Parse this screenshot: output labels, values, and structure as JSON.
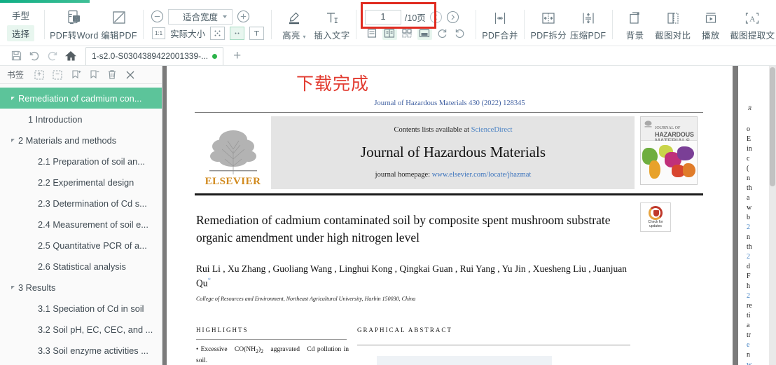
{
  "app": {
    "accent_color": "#13b188",
    "highlight_box_color": "#e02b20"
  },
  "ribbon": {
    "hand_label": "手型",
    "select_label": "选择",
    "buttons": [
      {
        "name": "pdf-to-word",
        "label": "PDF转Word",
        "icon": "word-convert-icon"
      },
      {
        "name": "edit-pdf",
        "label": "编辑PDF",
        "icon": "pencil-square-icon"
      }
    ],
    "zoom": {
      "minus_label": "−",
      "plus_label": "+",
      "level": "适合宽度",
      "actual_size_label": "实际大小",
      "ratio_badge": "1:1"
    },
    "annotate": [
      {
        "name": "highlight",
        "label": "高亮",
        "icon": "marker-icon",
        "has_dropdown": true
      },
      {
        "name": "insert-text",
        "label": "插入文字",
        "icon": "text-insert-icon"
      }
    ],
    "pagenav": {
      "current_page": "1",
      "total_label": "/10页",
      "prev_title": "上一页",
      "next_title": "下一页"
    },
    "tools": [
      {
        "name": "pdf-merge",
        "label": "PDF合并",
        "icon": "merge-icon"
      },
      {
        "name": "pdf-split",
        "label": "PDF拆分",
        "icon": "split-icon"
      },
      {
        "name": "compress-pdf",
        "label": "压缩PDF",
        "icon": "compress-icon"
      },
      {
        "name": "background",
        "label": "背景",
        "icon": "layers-icon"
      },
      {
        "name": "screenshot-compare",
        "label": "截图对比",
        "icon": "compare-icon"
      },
      {
        "name": "play",
        "label": "播放",
        "icon": "play-icon"
      },
      {
        "name": "screenshot-ocr",
        "label": "截图提取文",
        "icon": "ocr-icon"
      }
    ]
  },
  "tabstrip": {
    "save_title": "保存",
    "undo_title": "撤销",
    "redo_title": "恢复",
    "home_title": "首页",
    "tab_label": "1-s2.0-S0304389422001339-...",
    "add_tab_label": "+"
  },
  "sidebar": {
    "title": "书签",
    "tools": [
      {
        "name": "expand-all-icon",
        "label": "展开全部"
      },
      {
        "name": "collapse-all-icon",
        "label": "折叠全部"
      },
      {
        "name": "add-bookmark-icon",
        "label": "添加书签"
      },
      {
        "name": "remove-bookmark-icon",
        "label": "删除书签"
      },
      {
        "name": "delete-icon",
        "label": "删除"
      },
      {
        "name": "close-icon",
        "label": "关闭"
      }
    ],
    "items": [
      {
        "label": "Remediation of cadmium con...",
        "indent": 0,
        "arrow": true,
        "selected": true
      },
      {
        "label": "1 Introduction",
        "indent": 1,
        "arrow": false,
        "selected": false
      },
      {
        "label": "2 Materials and methods",
        "indent": 0,
        "arrow": true,
        "selected": false
      },
      {
        "label": "2.1 Preparation of soil an...",
        "indent": 2,
        "arrow": false,
        "selected": false
      },
      {
        "label": "2.2 Experimental design",
        "indent": 2,
        "arrow": false,
        "selected": false
      },
      {
        "label": "2.3 Determination of Cd s...",
        "indent": 2,
        "arrow": false,
        "selected": false
      },
      {
        "label": "2.4 Measurement of soil e...",
        "indent": 2,
        "arrow": false,
        "selected": false
      },
      {
        "label": "2.5 Quantitative PCR of a...",
        "indent": 2,
        "arrow": false,
        "selected": false
      },
      {
        "label": "2.6 Statistical analysis",
        "indent": 2,
        "arrow": false,
        "selected": false
      },
      {
        "label": "3 Results",
        "indent": 0,
        "arrow": true,
        "selected": false
      },
      {
        "label": "3.1 Speciation of Cd in soil",
        "indent": 2,
        "arrow": false,
        "selected": false
      },
      {
        "label": "3.2 Soil pH, EC, CEC, and ...",
        "indent": 2,
        "arrow": false,
        "selected": false
      },
      {
        "label": "3.3 Soil enzyme activities ...",
        "indent": 2,
        "arrow": false,
        "selected": false
      }
    ]
  },
  "document": {
    "download_notice": "下载完成",
    "journal_citation": "Journal of Hazardous Materials 430 (2022) 128345",
    "header": {
      "contents_prefix": "Contents lists available at ",
      "contents_link": "ScienceDirect",
      "journal_title": "Journal of Hazardous Materials",
      "homepage_prefix": "journal homepage: ",
      "homepage_link": "www.elsevier.com/locate/jhazmat",
      "publisher": "ELSEVIER"
    },
    "cover": {
      "line1": "JOURNAL OF",
      "line2": "HAZARDOUS",
      "line3": "MATERIALS"
    },
    "check_updates": {
      "line1": "Check for",
      "line2": "updates"
    },
    "title": "Remediation of cadmium contaminated soil by composite spent mushroom substrate organic amendment under high nitrogen level",
    "authors": "Rui Li , Xu Zhang , Guoliang Wang , Linghui Kong , Qingkai Guan , Rui Yang , Yu Jin , Xuesheng Liu , Juanjuan Qu",
    "affiliation": "College of Resources and Environment, Northeast Agricultural University, Harbin 150030, China",
    "highlights_heading": "HIGHLIGHTS",
    "graphical_abstract_heading": "GRAPHICAL ABSTRACT",
    "highlight_item": "Excessive CO(NH2)2 aggravated Cd pollution in soil."
  },
  "page2": {
    "header": "R",
    "lines": [
      "o",
      "E",
      "in",
      "c",
      "(",
      "n",
      "th",
      "a",
      "w",
      "b",
      "2",
      "n",
      "th",
      "2",
      "d",
      "F",
      "h",
      "2",
      "re",
      "ti",
      "a",
      "tr",
      "e",
      "n",
      "w"
    ],
    "blue_line_indices": [
      10,
      13,
      17,
      22,
      24
    ]
  }
}
